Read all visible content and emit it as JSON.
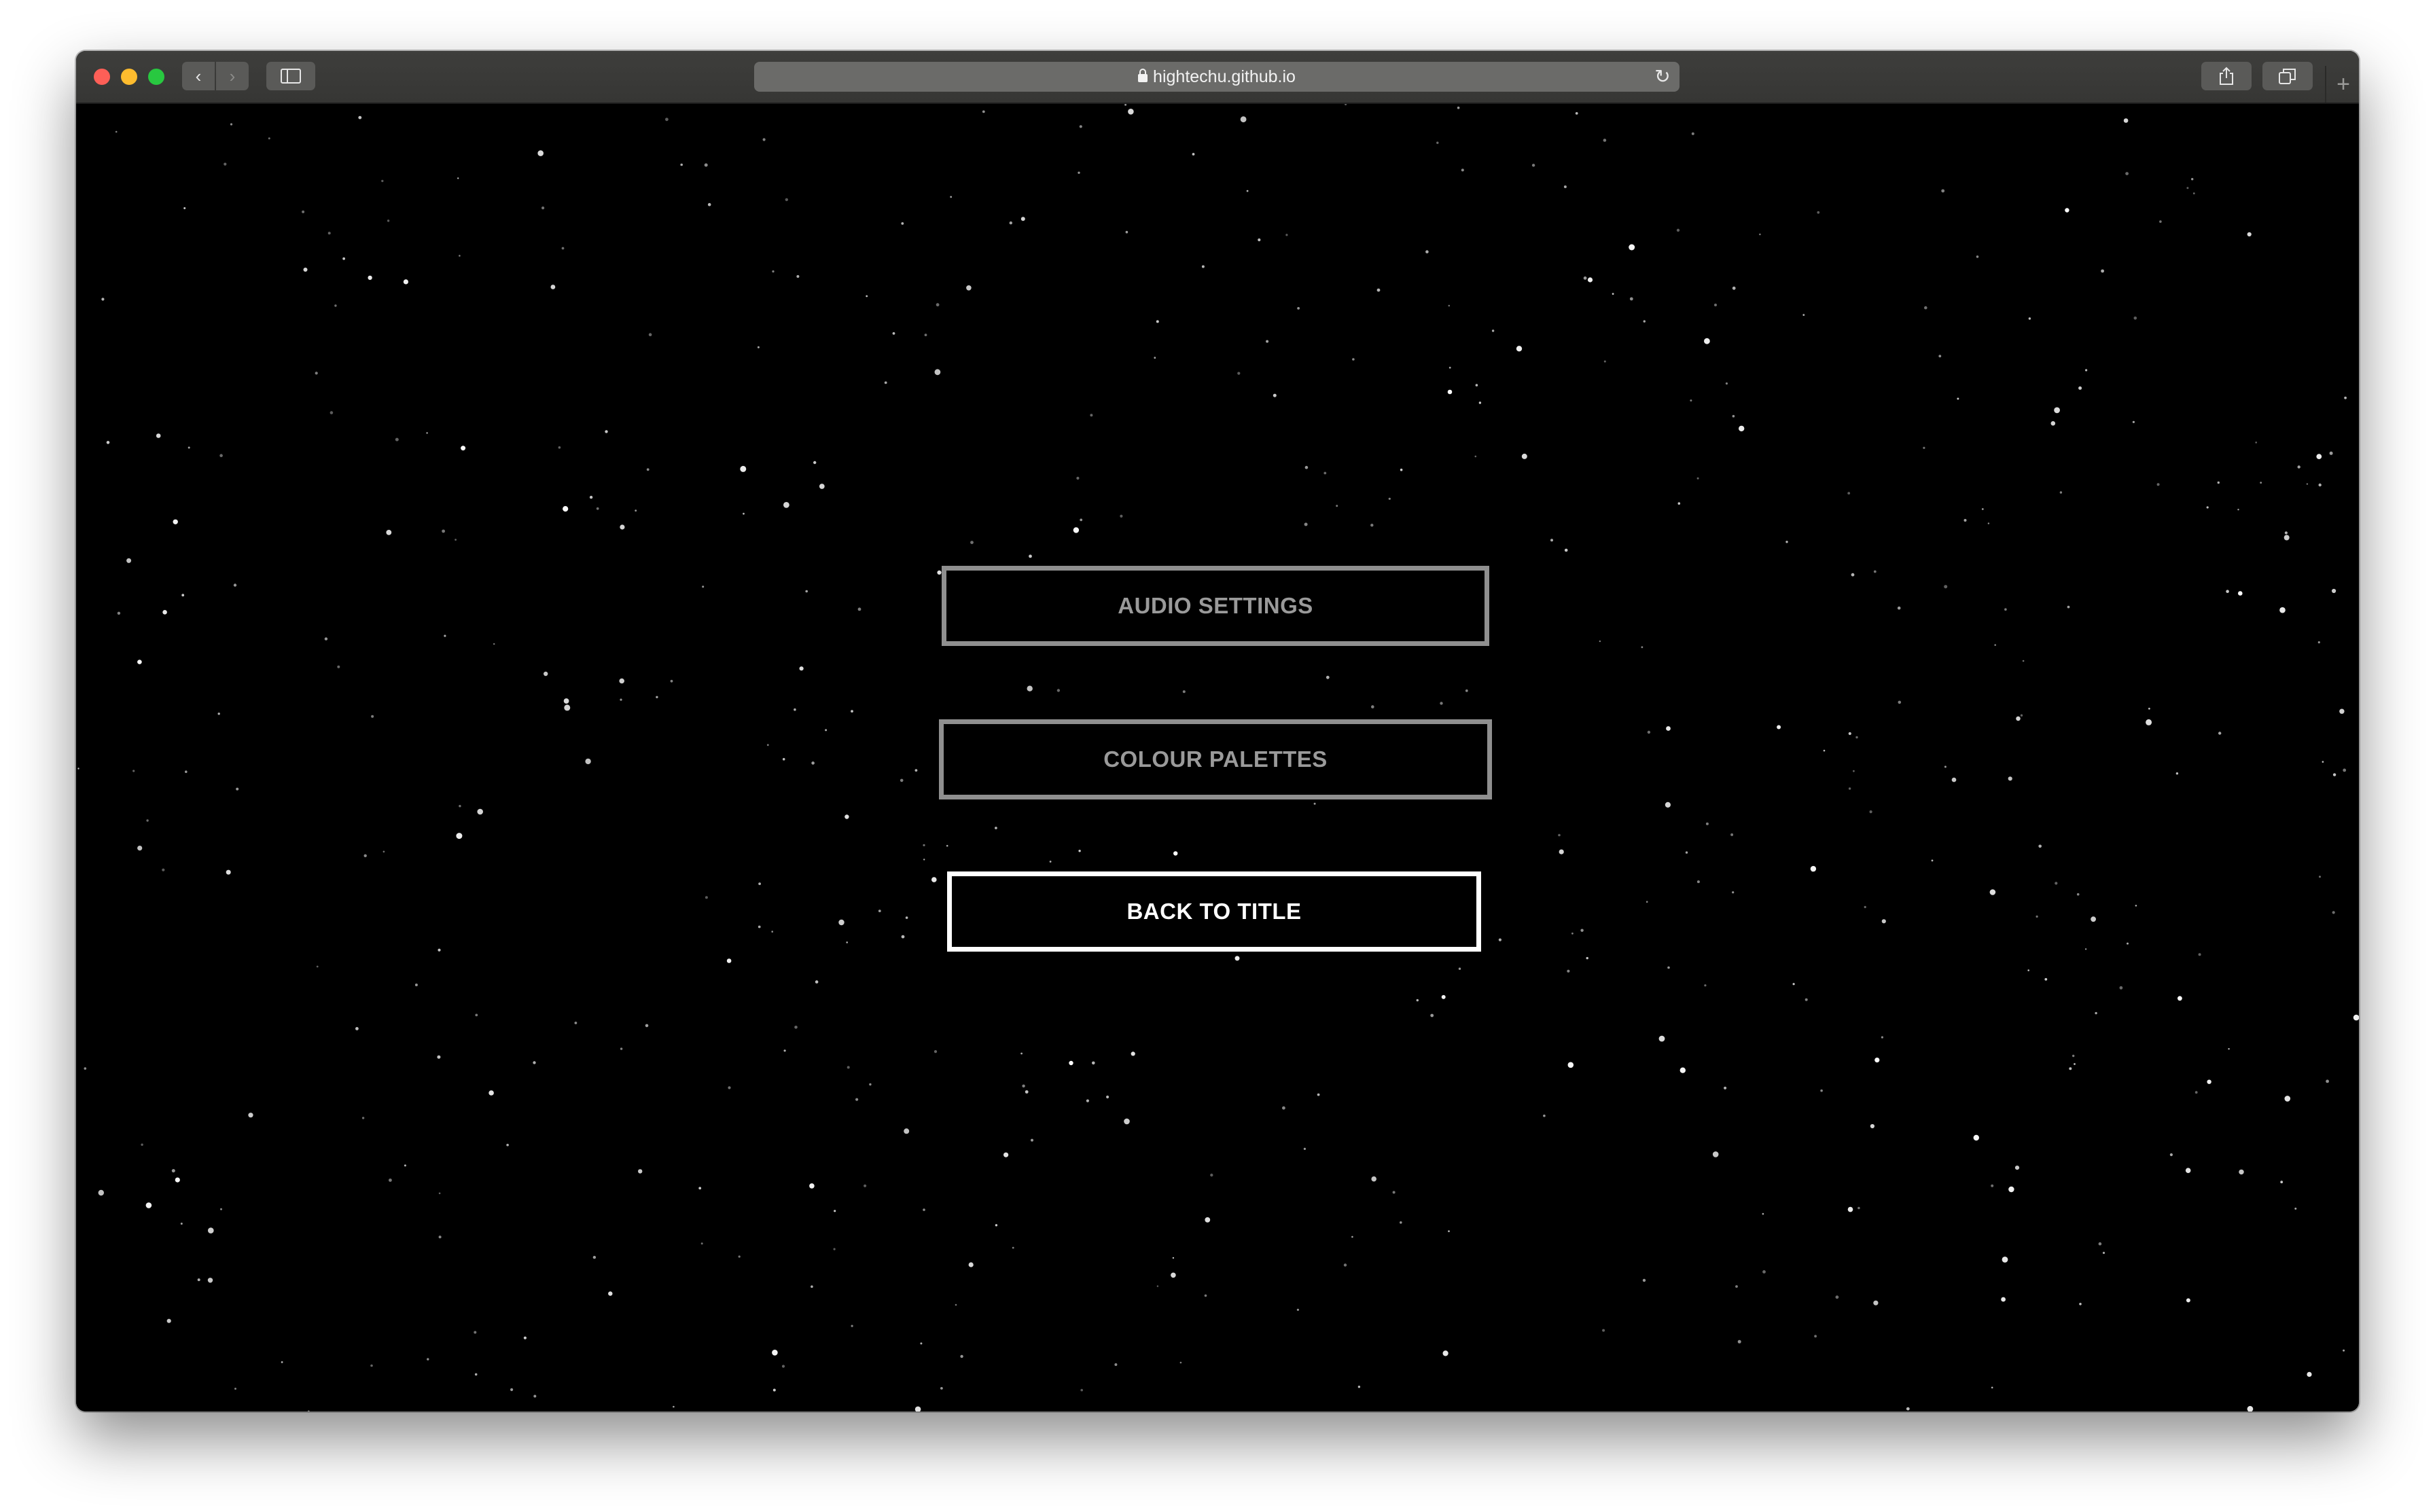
{
  "browser": {
    "url": "hightechu.github.io",
    "back_icon": "‹",
    "forward_icon": "›",
    "reload_icon": "↻",
    "new_tab_icon": "+"
  },
  "menu": {
    "buttons": [
      {
        "label": "AUDIO SETTINGS",
        "state": "default"
      },
      {
        "label": "COLOUR PALETTES",
        "state": "default"
      },
      {
        "label": "BACK TO TITLE",
        "state": "highlighted"
      }
    ]
  },
  "colors": {
    "background": "#000000",
    "button_default": "#8f8f8f",
    "button_highlighted": "#ffffff",
    "star": "#ffffff"
  }
}
